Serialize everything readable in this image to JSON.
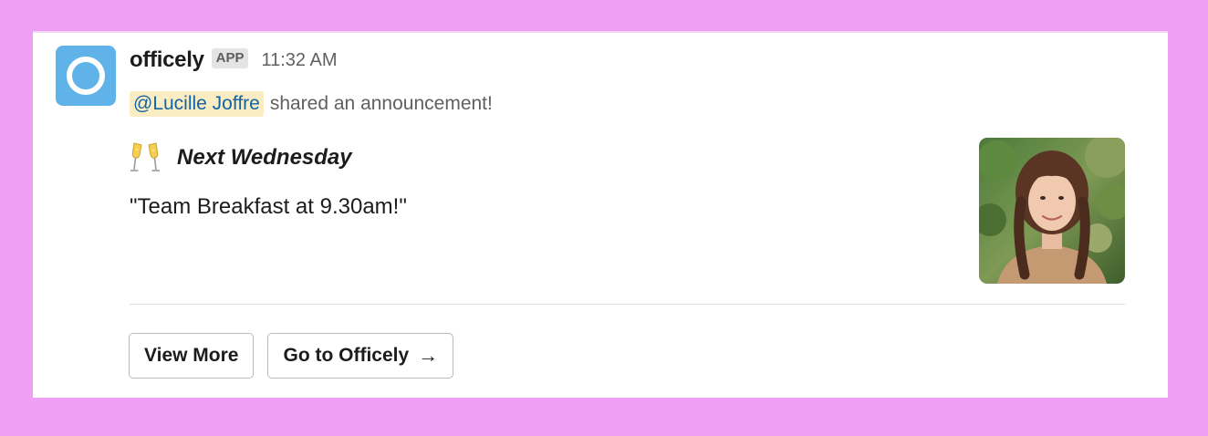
{
  "message": {
    "app_name": "officely",
    "badge": "APP",
    "time": "11:32 AM",
    "mention": "@Lucille Joffre",
    "action_text": "shared an announcement!",
    "title_emoji": "champagne-glasses-icon",
    "title": "Next Wednesday",
    "body": "\"Team Breakfast at 9.30am!\""
  },
  "buttons": {
    "view_more": "View More",
    "go_to": "Go to Officely",
    "go_to_arrow": "→"
  },
  "colors": {
    "background": "#efa0f4",
    "avatar": "#5fb3e8",
    "mention_bg": "#fbedc3",
    "mention_text": "#1264a3"
  }
}
